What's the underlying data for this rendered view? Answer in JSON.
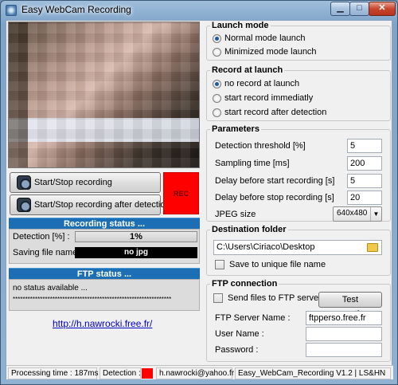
{
  "window": {
    "title": "Easy WebCam Recording"
  },
  "buttons": {
    "record": "Start/Stop recording",
    "record_after_detection": "Start/Stop recording after detection",
    "rec_indicator": "REC"
  },
  "recording_status": {
    "header": "Recording status ...",
    "detection_label": "Detection [%] :",
    "detection_value": "1%",
    "saving_label": "Saving file name :",
    "saving_value": "no jpg"
  },
  "ftp_status": {
    "header": "FTP status ...",
    "line1": "no status available ...",
    "line2": "****************************************************************"
  },
  "link": "http://h.nawrocki.free.fr/",
  "launch_mode": {
    "title": "Launch mode",
    "options": [
      "Normal mode launch",
      "Minimized mode launch"
    ]
  },
  "record_at_launch": {
    "title": "Record at launch",
    "options": [
      "no record at launch",
      "start record immediatly",
      "start record after detection"
    ]
  },
  "parameters": {
    "title": "Parameters",
    "detection_threshold_label": "Detection threshold [%]",
    "detection_threshold_value": "5",
    "sampling_time_label": "Sampling time [ms]",
    "sampling_time_value": "200",
    "delay_start_label": "Delay before start recording [s]",
    "delay_start_value": "5",
    "delay_stop_label": "Delay before stop recording [s]",
    "delay_stop_value": "20",
    "jpeg_size_label": "JPEG size",
    "jpeg_size_value": "640x480"
  },
  "destination": {
    "title": "Destination folder",
    "path": "C:\\Users\\Ciriaco\\Desktop",
    "unique_label": "Save to unique file name"
  },
  "ftp_connection": {
    "title": "FTP connection",
    "send_label": "Send files to FTP server",
    "test_button": "Test connection..",
    "server_label": "FTP Server Name :",
    "server_value": "ftpperso.free.fr",
    "user_label": "User Name :",
    "user_value": "",
    "password_label": "Password :",
    "password_value": ""
  },
  "statusbar": {
    "processing": "Processing time : 187ms",
    "detection": "Detection :",
    "email": "h.nawrocki@yahoo.fr",
    "version": "Easy_WebCam_Recording V1.2 | LS&HN"
  }
}
